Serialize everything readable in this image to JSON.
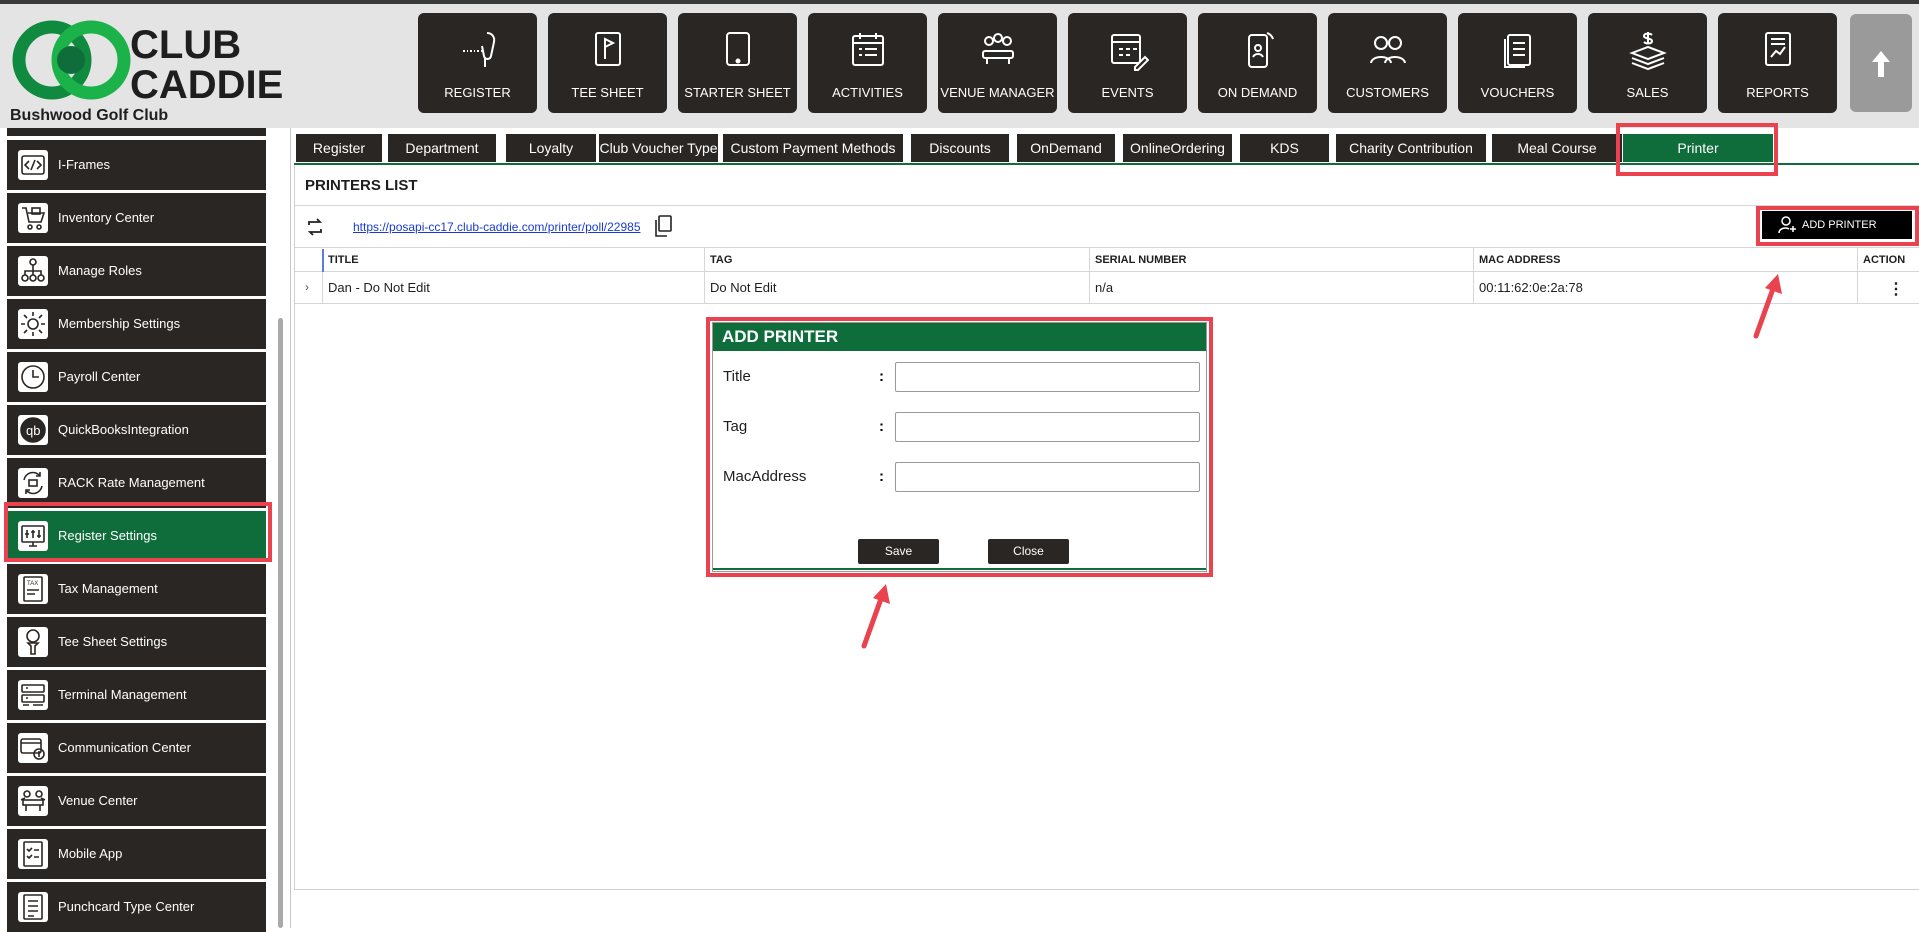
{
  "header": {
    "logo_line1": "CLUB",
    "logo_line2": "CADDIE",
    "club_name": "Bushwood Golf Club",
    "nav": [
      {
        "label": "REGISTER",
        "icon": "barcode-scanner-icon"
      },
      {
        "label": "TEE SHEET",
        "icon": "flag-icon"
      },
      {
        "label": "STARTER SHEET",
        "icon": "tablet-icon"
      },
      {
        "label": "ACTIVITIES",
        "icon": "calendar-list-icon"
      },
      {
        "label": "VENUE MANAGER",
        "icon": "meeting-table-icon"
      },
      {
        "label": "EVENTS",
        "icon": "calendar-pencil-icon"
      },
      {
        "label": "ON DEMAND",
        "icon": "mobile-order-icon"
      },
      {
        "label": "CUSTOMERS",
        "icon": "people-group-icon"
      },
      {
        "label": "VOUCHERS",
        "icon": "voucher-stack-icon"
      },
      {
        "label": "SALES",
        "icon": "money-stack-icon"
      },
      {
        "label": "REPORTS",
        "icon": "report-chart-icon"
      }
    ],
    "up_icon": "arrow-up-icon"
  },
  "sidebar": {
    "items": [
      {
        "label": "I-Frames",
        "icon": "code-frame-icon"
      },
      {
        "label": "Inventory Center",
        "icon": "inventory-cart-icon"
      },
      {
        "label": "Manage Roles",
        "icon": "org-chart-icon"
      },
      {
        "label": "Membership Settings",
        "icon": "gear-icon"
      },
      {
        "label": "Payroll Center",
        "icon": "clock-icon"
      },
      {
        "label": "QuickBooksIntegration",
        "icon": "quickbooks-icon"
      },
      {
        "label": "RACK Rate Management",
        "icon": "rate-cycle-icon"
      },
      {
        "label": "Register Settings",
        "icon": "register-sliders-icon"
      },
      {
        "label": "Tax Management",
        "icon": "tax-document-icon"
      },
      {
        "label": "Tee Sheet Settings",
        "icon": "golf-tee-icon"
      },
      {
        "label": "Terminal Management",
        "icon": "terminal-sliders-icon"
      },
      {
        "label": "Communication Center",
        "icon": "credit-card-icon"
      },
      {
        "label": "Venue Center",
        "icon": "venue-table-icon"
      },
      {
        "label": "Mobile App",
        "icon": "checklist-icon"
      },
      {
        "label": "Punchcard Type Center",
        "icon": "punchcard-list-icon"
      }
    ],
    "active": "Register Settings"
  },
  "tabs": [
    "Register",
    "Department",
    "Loyalty",
    "Club Voucher Type",
    "Custom Payment Methods",
    "Discounts",
    "OnDemand",
    "OnlineOrdering",
    "KDS",
    "Charity Contribution",
    "Meal Course",
    "Printer"
  ],
  "active_tab": "Printer",
  "printers": {
    "title": "PRINTERS LIST",
    "poll_url": "https://posapi-cc17.club-caddie.com/printer/poll/22985",
    "add_button": "ADD PRINTER",
    "columns": [
      "TITLE",
      "TAG",
      "SERIAL NUMBER",
      "MAC ADDRESS",
      "ACTION"
    ],
    "rows": [
      {
        "title": "Dan - Do Not Edit",
        "tag": "Do Not Edit",
        "serial": "n/a",
        "mac": "00:11:62:0e:2a:78"
      }
    ]
  },
  "dialog": {
    "title": "ADD PRINTER",
    "fields": [
      {
        "label": "Title",
        "value": ""
      },
      {
        "label": "Tag",
        "value": ""
      },
      {
        "label": "MacAddress",
        "value": ""
      }
    ],
    "colon": ":",
    "save": "Save",
    "close": "Close"
  },
  "colors": {
    "brand_green": "#0f6c3b",
    "button_dark": "#2a2623",
    "highlight_red": "#e8434f",
    "link_blue": "#1a3bd1"
  }
}
